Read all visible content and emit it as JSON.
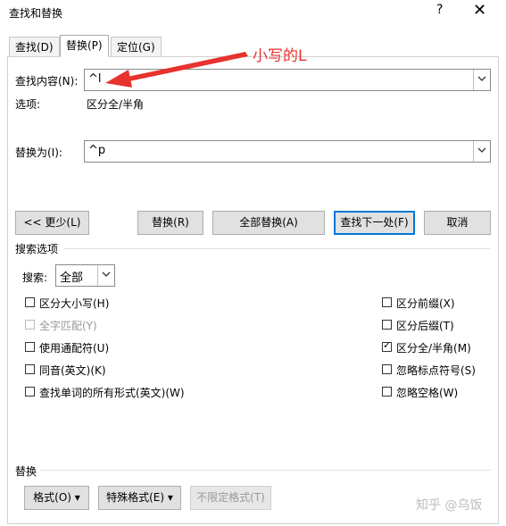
{
  "window": {
    "title": "查找和替换",
    "help": "?",
    "close": "✕"
  },
  "tabs": [
    {
      "label": "查找(D)"
    },
    {
      "label": "替换(P)"
    },
    {
      "label": "定位(G)"
    }
  ],
  "find": {
    "label": "查找内容(N):",
    "value": "^l"
  },
  "options": {
    "label": "选项:",
    "value": "区分全/半角"
  },
  "replace": {
    "label": "替换为(I):",
    "value": "^p"
  },
  "annotation": "小写的L",
  "buttons": {
    "less": "<< 更少(L)",
    "replace": "替换(R)",
    "replace_all": "全部替换(A)",
    "find_next": "查找下一处(F)",
    "cancel": "取消"
  },
  "search_options": {
    "title": "搜索选项",
    "search_label": "搜索:",
    "search_value": "全部",
    "left": [
      {
        "label": "区分大小写(H)",
        "checked": false,
        "disabled": false
      },
      {
        "label": "全字匹配(Y)",
        "checked": false,
        "disabled": true
      },
      {
        "label": "使用通配符(U)",
        "checked": false,
        "disabled": false
      },
      {
        "label": "同音(英文)(K)",
        "checked": false,
        "disabled": false
      },
      {
        "label": "查找单词的所有形式(英文)(W)",
        "checked": false,
        "disabled": false
      }
    ],
    "right": [
      {
        "label": "区分前缀(X)",
        "checked": false
      },
      {
        "label": "区分后缀(T)",
        "checked": false
      },
      {
        "label": "区分全/半角(M)",
        "checked": true
      },
      {
        "label": "忽略标点符号(S)",
        "checked": false
      },
      {
        "label": "忽略空格(W)",
        "checked": false
      }
    ]
  },
  "replace_section": {
    "title": "替换",
    "format": "格式(O) ▾",
    "special": "特殊格式(E) ▾",
    "no_format": "不限定格式(T)"
  },
  "watermark": "知乎 @乌饭",
  "colors": {
    "annotation": "#e8322d",
    "primary_border": "#0078d7"
  }
}
